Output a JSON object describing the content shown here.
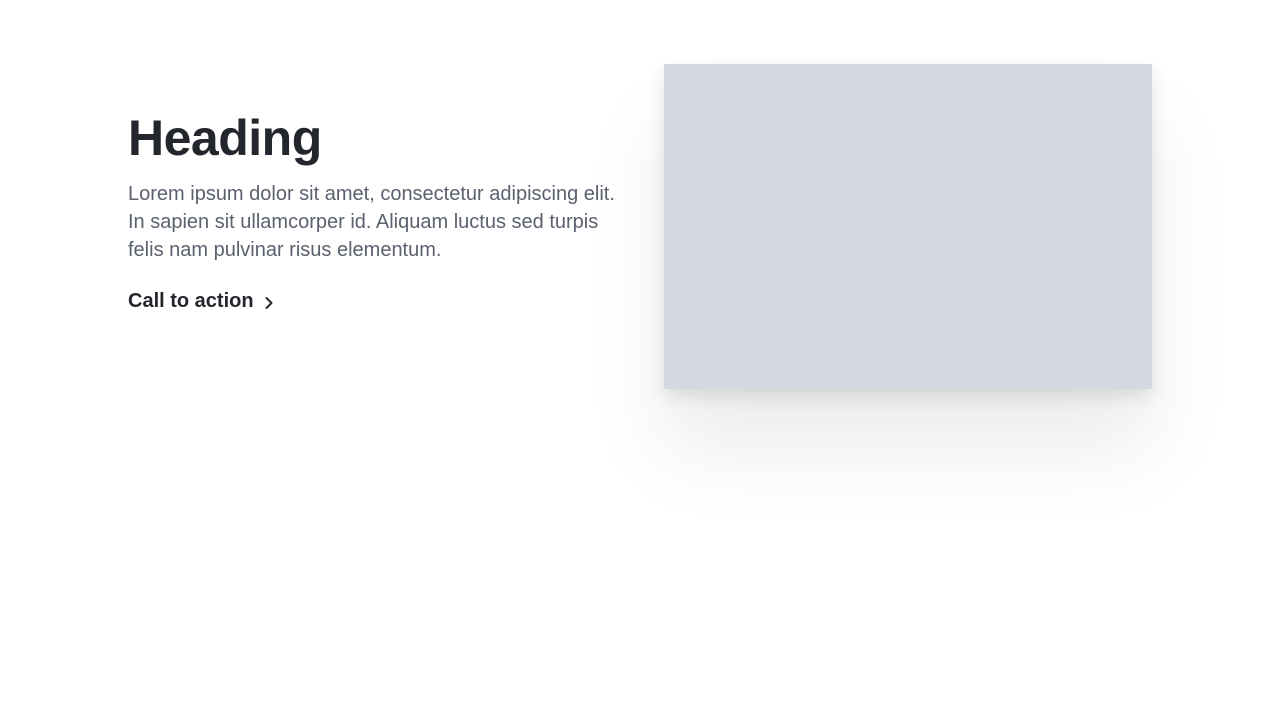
{
  "content": {
    "heading": "Heading",
    "body": "Lorem ipsum dolor sit amet, consectetur adipiscing elit. In sapien sit ullamcorper id. Aliquam luctus sed turpis felis nam pulvinar risus elementum.",
    "cta_label": "Call to action",
    "cta_icon": "chevron-right-icon"
  },
  "colors": {
    "heading": "#23262d",
    "body": "#5b616e",
    "placeholder": "#d4d8e0",
    "background": "#ffffff"
  }
}
